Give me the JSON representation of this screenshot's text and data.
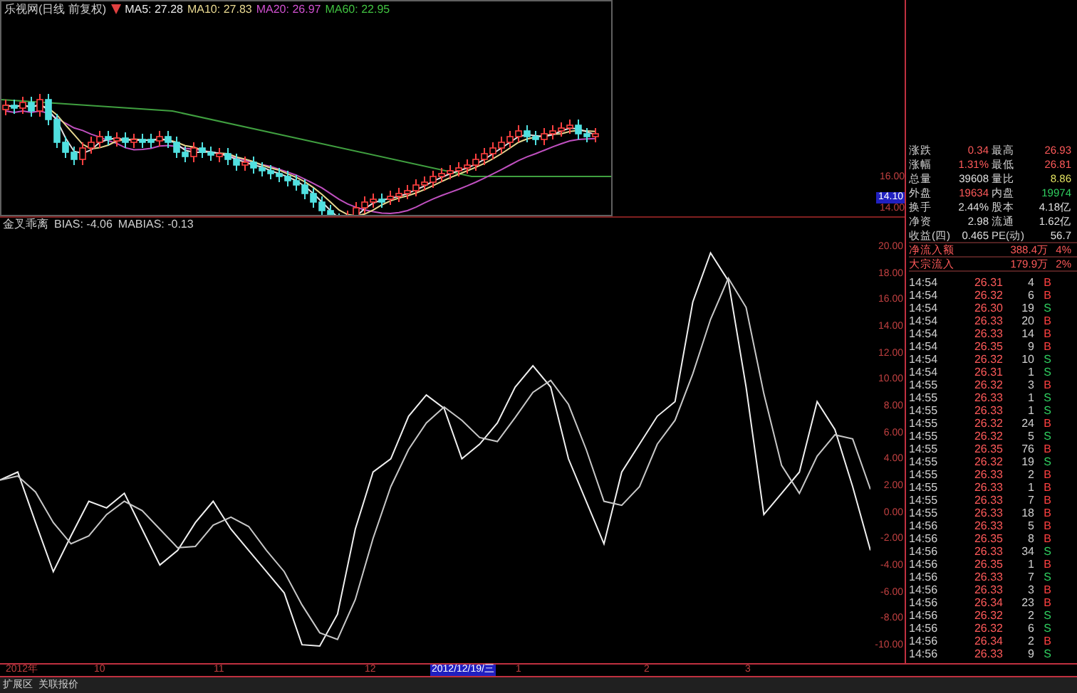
{
  "price_chart": {
    "title": "乐视网(日线 前复权)",
    "moving_averages": [
      {
        "label": "MA5: 27.28",
        "color": "#e8e8e8"
      },
      {
        "label": "MA10: 27.83",
        "color": "#e8d890"
      },
      {
        "label": "MA20: 26.97",
        "color": "#d050d0"
      },
      {
        "label": "MA60: 22.95",
        "color": "#40c040"
      }
    ],
    "axis_labels": [
      "16.00",
      "14.00"
    ],
    "cursor_value": "14.10"
  },
  "indicator_chart": {
    "title": "金叉乖离",
    "values": [
      "BIAS: -4.06",
      "MABIAS: -0.13"
    ],
    "chart_data": {
      "type": "line",
      "ylim": [
        -10,
        20
      ],
      "yticks": [
        {
          "value": 20,
          "label": "20.00"
        },
        {
          "value": 18,
          "label": "18.00"
        },
        {
          "value": 16,
          "label": "16.00"
        },
        {
          "value": 14,
          "label": "14.00"
        },
        {
          "value": 12,
          "label": "12.00"
        },
        {
          "value": 10,
          "label": "10.00"
        },
        {
          "value": 8,
          "label": "8.00"
        },
        {
          "value": 6,
          "label": "6.00"
        },
        {
          "value": 4,
          "label": "4.00"
        },
        {
          "value": 2,
          "label": "2.00"
        },
        {
          "value": 0,
          "label": "0.00"
        },
        {
          "value": -2,
          "label": "-2.00"
        },
        {
          "value": -4,
          "label": "-4.00"
        },
        {
          "value": -6,
          "label": "-6.00"
        },
        {
          "value": -8,
          "label": "-8.00"
        },
        {
          "value": -10,
          "label": "-10.00"
        }
      ],
      "series": [
        {
          "color": "#f0f0f0",
          "values": [
            2.5,
            3.1,
            -0.7,
            -4.4,
            -1.7,
            0.9,
            0.4,
            1.5,
            -1.2,
            -3.9,
            -2.8,
            -0.7,
            0.9,
            -1.2,
            -2.8,
            -4.4,
            -6.0,
            -9.9,
            -10.0,
            -7.6,
            -1.2,
            3.1,
            4.1,
            7.3,
            8.9,
            7.9,
            4.1,
            5.2,
            6.8,
            9.5,
            11.1,
            9.5,
            4.1,
            0.9,
            -2.3,
            3.1,
            5.2,
            7.3,
            8.4,
            15.9,
            19.6,
            17.5,
            9.5,
            -0.1,
            1.5,
            3.1,
            8.4,
            6.3,
            2.0,
            -2.8
          ]
        },
        {
          "color": "#c8c8c8",
          "values": [
            2.5,
            2.8,
            1.6,
            -0.7,
            -2.3,
            -1.7,
            -0.1,
            0.9,
            0.2,
            -1.2,
            -2.6,
            -2.5,
            -0.9,
            -0.3,
            -1.0,
            -2.8,
            -4.4,
            -6.9,
            -9.0,
            -9.5,
            -6.5,
            -1.9,
            2.0,
            4.8,
            6.8,
            8.0,
            7.0,
            5.7,
            5.4,
            7.2,
            9.1,
            10.0,
            8.2,
            4.8,
            0.9,
            0.6,
            2.0,
            5.2,
            7.0,
            10.5,
            14.6,
            17.7,
            15.5,
            9.0,
            3.6,
            1.5,
            4.3,
            5.9,
            5.6,
            1.8
          ]
        }
      ]
    }
  },
  "quote": {
    "items": [
      {
        "label": "涨跌",
        "value": "0.34",
        "color": "#ff5a5a"
      },
      {
        "label": "最高",
        "value": "26.93",
        "color": "#ff5a5a"
      },
      {
        "label": "涨幅",
        "value": "1.31%",
        "color": "#ff5a5a"
      },
      {
        "label": "最低",
        "value": "26.81",
        "color": "#ff5a5a"
      },
      {
        "label": "总量",
        "value": "39608",
        "color": "#e0e0e0"
      },
      {
        "label": "量比",
        "value": "8.86",
        "color": "#e0e060"
      },
      {
        "label": "外盘",
        "value": "19634",
        "color": "#ff5a5a"
      },
      {
        "label": "内盘",
        "value": "19974",
        "color": "#30d060"
      },
      {
        "label": "换手",
        "value": "2.44%",
        "color": "#e0e0e0"
      },
      {
        "label": "股本",
        "value": "4.18亿",
        "color": "#e0e0e0"
      },
      {
        "label": "净资",
        "value": "2.98",
        "color": "#e0e0e0"
      },
      {
        "label": "流通",
        "value": "1.62亿",
        "color": "#e0e0e0"
      },
      {
        "label": "收益(四)",
        "value": "0.465",
        "color": "#e0e0e0"
      },
      {
        "label": "PE(动)",
        "value": "56.7",
        "color": "#e0e0e0"
      }
    ],
    "flows": [
      {
        "label": "净流入额",
        "value": "388.4万",
        "share": "4%"
      },
      {
        "label": "大宗流入",
        "value": "179.9万",
        "share": "2%"
      }
    ]
  },
  "trades": [
    {
      "time": "14:54",
      "price": "26.31",
      "volume": "4",
      "flag": "B",
      "color": "#ff4040"
    },
    {
      "time": "14:54",
      "price": "26.32",
      "volume": "6",
      "flag": "B",
      "color": "#ff4040"
    },
    {
      "time": "14:54",
      "price": "26.30",
      "volume": "19",
      "flag": "S",
      "color": "#30d060"
    },
    {
      "time": "14:54",
      "price": "26.33",
      "volume": "20",
      "flag": "B",
      "color": "#ff4040"
    },
    {
      "time": "14:54",
      "price": "26.33",
      "volume": "14",
      "flag": "B",
      "color": "#ff4040"
    },
    {
      "time": "14:54",
      "price": "26.35",
      "volume": "9",
      "flag": "B",
      "color": "#ff4040"
    },
    {
      "time": "14:54",
      "price": "26.32",
      "volume": "10",
      "flag": "S",
      "color": "#30d060"
    },
    {
      "time": "14:54",
      "price": "26.31",
      "volume": "1",
      "flag": "S",
      "color": "#30d060"
    },
    {
      "time": "14:55",
      "price": "26.32",
      "volume": "3",
      "flag": "B",
      "color": "#ff4040"
    },
    {
      "time": "14:55",
      "price": "26.33",
      "volume": "1",
      "flag": "S",
      "color": "#30d060"
    },
    {
      "time": "14:55",
      "price": "26.33",
      "volume": "1",
      "flag": "S",
      "color": "#30d060"
    },
    {
      "time": "14:55",
      "price": "26.32",
      "volume": "24",
      "flag": "B",
      "color": "#ff4040"
    },
    {
      "time": "14:55",
      "price": "26.32",
      "volume": "5",
      "flag": "S",
      "color": "#30d060"
    },
    {
      "time": "14:55",
      "price": "26.35",
      "volume": "76",
      "flag": "B",
      "color": "#ff4040"
    },
    {
      "time": "14:55",
      "price": "26.32",
      "volume": "19",
      "flag": "S",
      "color": "#30d060"
    },
    {
      "time": "14:55",
      "price": "26.33",
      "volume": "2",
      "flag": "B",
      "color": "#ff4040"
    },
    {
      "time": "14:55",
      "price": "26.33",
      "volume": "1",
      "flag": "B",
      "color": "#ff4040"
    },
    {
      "time": "14:55",
      "price": "26.33",
      "volume": "7",
      "flag": "B",
      "color": "#ff4040"
    },
    {
      "time": "14:55",
      "price": "26.33",
      "volume": "18",
      "flag": "B",
      "color": "#ff4040"
    },
    {
      "time": "14:56",
      "price": "26.33",
      "volume": "5",
      "flag": "B",
      "color": "#ff4040"
    },
    {
      "time": "14:56",
      "price": "26.35",
      "volume": "8",
      "flag": "B",
      "color": "#ff4040"
    },
    {
      "time": "14:56",
      "price": "26.33",
      "volume": "34",
      "flag": "S",
      "color": "#30d060"
    },
    {
      "time": "14:56",
      "price": "26.35",
      "volume": "1",
      "flag": "B",
      "color": "#ff4040"
    },
    {
      "time": "14:56",
      "price": "26.33",
      "volume": "7",
      "flag": "S",
      "color": "#30d060"
    },
    {
      "time": "14:56",
      "price": "26.33",
      "volume": "3",
      "flag": "B",
      "color": "#ff4040"
    },
    {
      "time": "14:56",
      "price": "26.34",
      "volume": "23",
      "flag": "B",
      "color": "#ff4040"
    },
    {
      "time": "14:56",
      "price": "26.32",
      "volume": "2",
      "flag": "S",
      "color": "#30d060"
    },
    {
      "time": "14:56",
      "price": "26.32",
      "volume": "6",
      "flag": "S",
      "color": "#30d060"
    },
    {
      "time": "14:56",
      "price": "26.34",
      "volume": "2",
      "flag": "B",
      "color": "#ff4040"
    },
    {
      "time": "14:56",
      "price": "26.33",
      "volume": "9",
      "flag": "S",
      "color": "#30d060"
    }
  ],
  "time_axis": [
    {
      "label": "2012年",
      "selected": false
    },
    {
      "label": "10",
      "selected": false
    },
    {
      "label": "11",
      "selected": false
    },
    {
      "label": "12",
      "selected": false
    },
    {
      "label": "2012/12/19/三",
      "selected": true
    },
    {
      "label": "1",
      "selected": false
    },
    {
      "label": "2",
      "selected": false
    },
    {
      "label": "3",
      "selected": false
    }
  ],
  "status_bar": {
    "items": [
      "扩展区",
      "关联报价"
    ]
  }
}
